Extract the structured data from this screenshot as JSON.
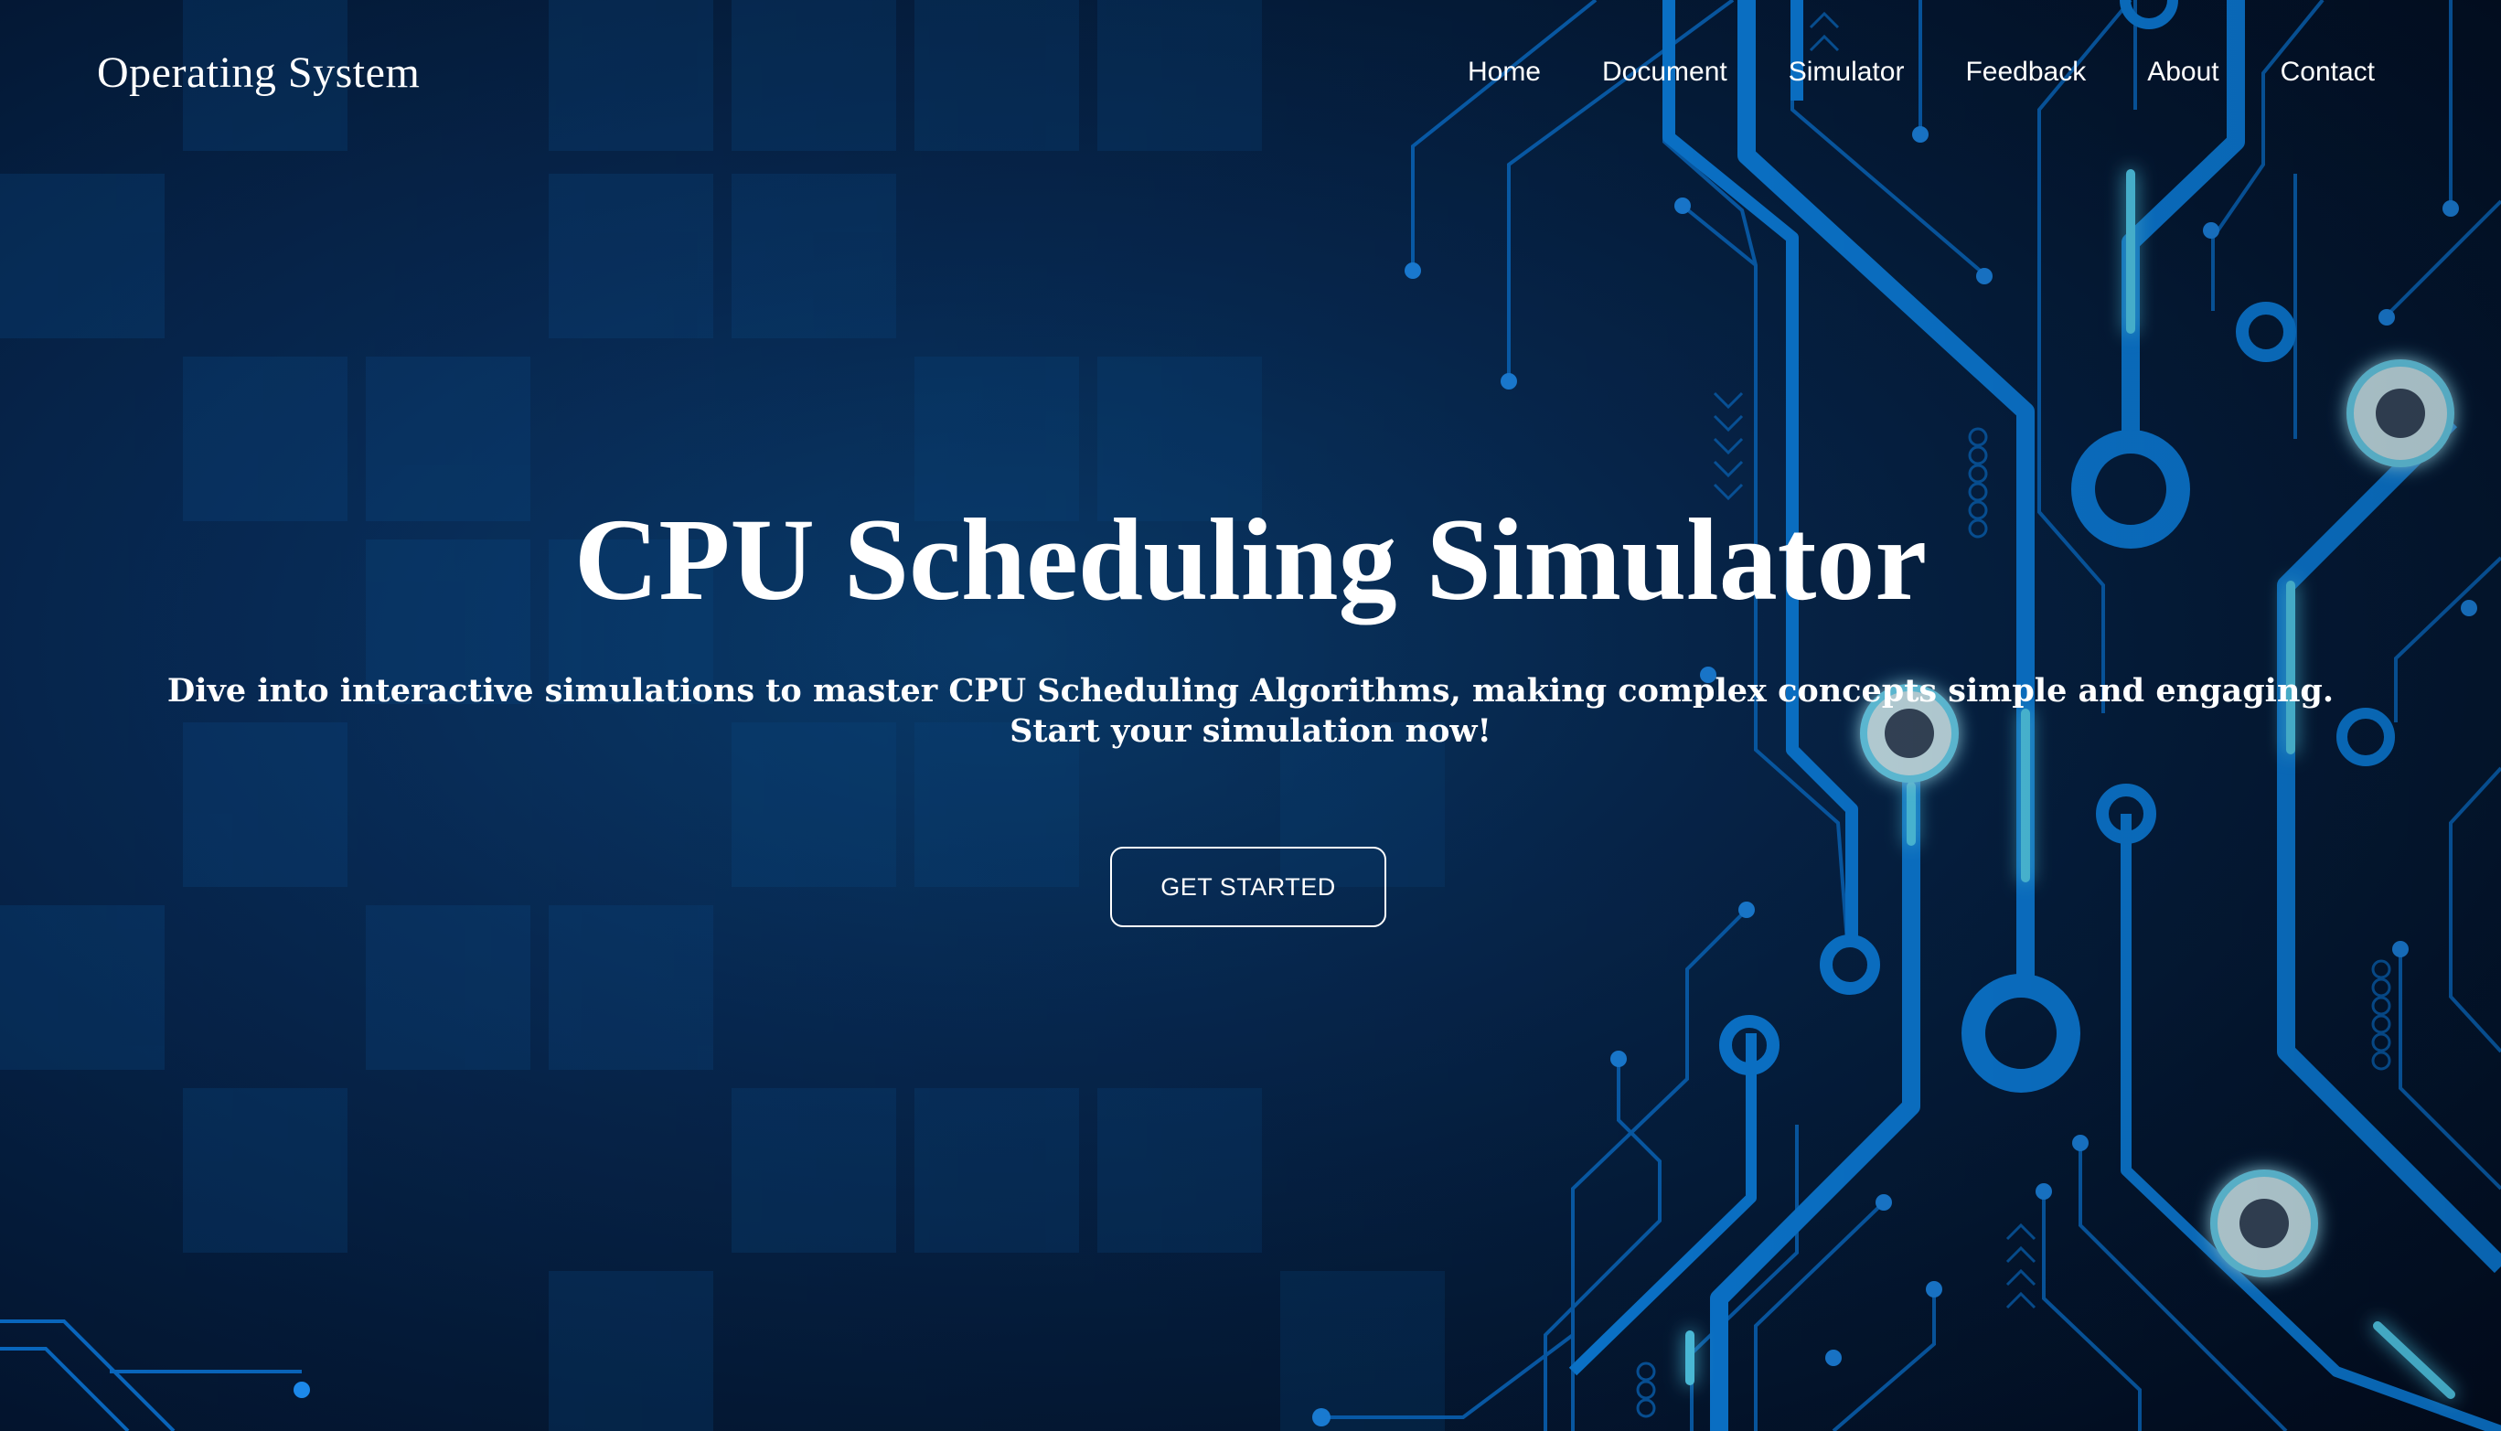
{
  "brand": {
    "title": "Operating System"
  },
  "nav": {
    "items": [
      {
        "label": "Home"
      },
      {
        "label": "Document"
      },
      {
        "label": "Simulator"
      },
      {
        "label": "Feedback"
      },
      {
        "label": "About"
      },
      {
        "label": "Contact"
      }
    ]
  },
  "hero": {
    "title": "CPU Scheduling Simulator",
    "subtitle_line1": "Dive into interactive simulations to master CPU Scheduling Algorithms, making complex concepts simple and engaging.",
    "subtitle_line2": "Start your simulation now!",
    "cta_label": "GET STARTED"
  },
  "colors": {
    "background": "#041a38",
    "accent_glow": "#33c8ff",
    "circuit": "#0a7fe0",
    "text": "#ffffff"
  },
  "decoration": {
    "background_art": "circuit-board-illustration"
  }
}
